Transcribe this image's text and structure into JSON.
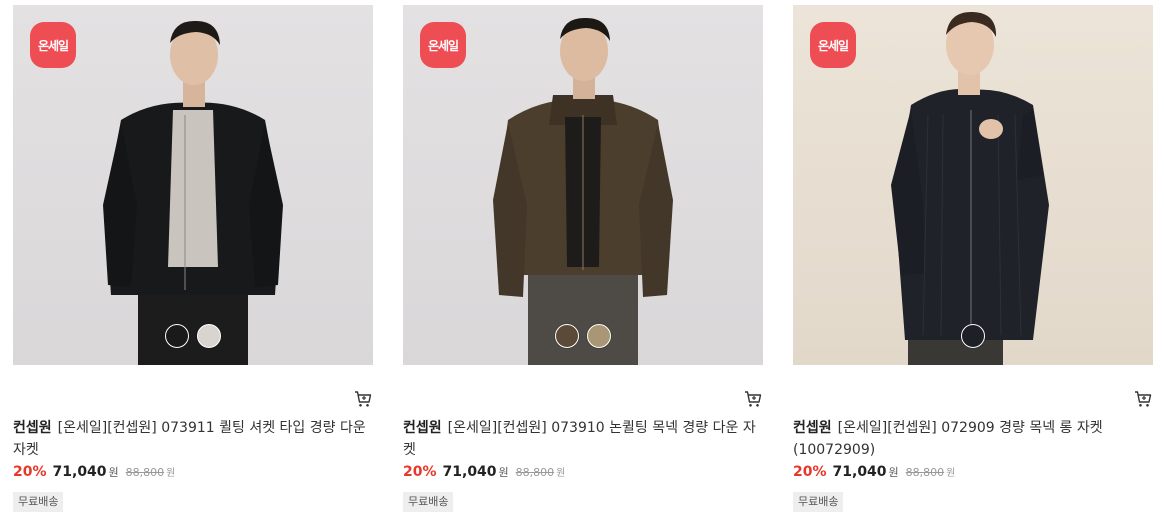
{
  "products": [
    {
      "badge": "온세일",
      "brand": "컨셉원",
      "name": "[온세일][컨셉원] 073911 퀼팅 셔켓 타입 경량 다운 자켓",
      "discount": "20%",
      "price": "71,040",
      "price_unit": "원",
      "original_price": "88,800",
      "original_unit": "원",
      "tag": "무료배송",
      "bg": "#dedcdd",
      "swatches": [
        "#1a1a1a",
        "#d8d4cf"
      ]
    },
    {
      "badge": "온세일",
      "brand": "컨셉원",
      "name": "[온세일][컨셉원] 073910 논퀼팅 목넥 경량 다운 자켓",
      "discount": "20%",
      "price": "71,040",
      "price_unit": "원",
      "original_price": "88,800",
      "original_unit": "원",
      "tag": "무료배송",
      "bg": "#dedcdd",
      "swatches": [
        "#5a4a37",
        "#a89676"
      ]
    },
    {
      "badge": "온세일",
      "brand": "컨셉원",
      "name": "[온세일][컨셉원] 072909 경량 목넥 롱 자켓 (10072909)",
      "discount": "20%",
      "price": "71,040",
      "price_unit": "원",
      "original_price": "88,800",
      "original_unit": "원",
      "tag": "무료배송",
      "bg": "#e6ddd0",
      "swatches": [
        "#1d2026"
      ]
    }
  ]
}
